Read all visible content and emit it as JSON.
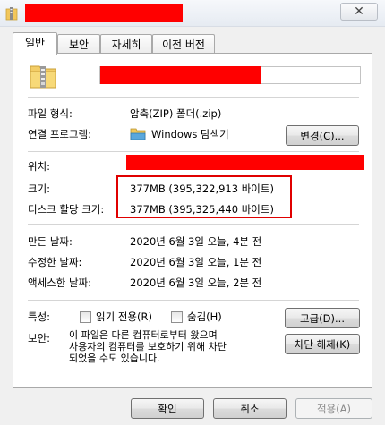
{
  "window": {
    "close_glyph": "✕",
    "title_icon": "zip-folder-icon"
  },
  "tabs": [
    {
      "label": "일반"
    },
    {
      "label": "보안"
    },
    {
      "label": "자세히"
    },
    {
      "label": "이전 버전"
    }
  ],
  "general": {
    "file_icon": "zip-folder-icon",
    "type_label": "파일 형식:",
    "type_value": "압축(ZIP) 폴더(.zip)",
    "opens_with_label": "연결 프로그램:",
    "opens_with_value": "Windows 탐색기",
    "opens_with_icon": "explorer-folder-icon",
    "change_button": "변경(C)...",
    "location_label": "위치:",
    "size_label": "크기:",
    "size_value": "377MB (395,322,913 바이트)",
    "size_on_disk_label": "디스크 할당 크기:",
    "size_on_disk_value": "377MB (395,325,440 바이트)",
    "created_label": "만든 날짜:",
    "created_value": "2020년 6월 3일 오늘, 4분 전",
    "modified_label": "수정한 날짜:",
    "modified_value": "2020년 6월 3일 오늘, 1분 전",
    "accessed_label": "액세스한 날짜:",
    "accessed_value": "2020년 6월 3일 오늘, 2분 전",
    "attributes_label": "특성:",
    "readonly_label": "읽기 전용(R)",
    "readonly_checked": false,
    "hidden_label": "숨김(H)",
    "hidden_checked": false,
    "advanced_button": "고급(D)...",
    "security_label": "보안:",
    "security_text_1": "이 파일은 다른 컴퓨터로부터 왔으며",
    "security_text_2": "사용자의 컴퓨터를 보호하기 위해 차단",
    "security_text_3": "되었을 수도 있습니다.",
    "unblock_button": "차단 해제(K)"
  },
  "footer": {
    "ok": "확인",
    "cancel": "취소",
    "apply": "적용(A)"
  },
  "colors": {
    "redaction": "#ff0000",
    "highlight_box": "#e00000"
  }
}
